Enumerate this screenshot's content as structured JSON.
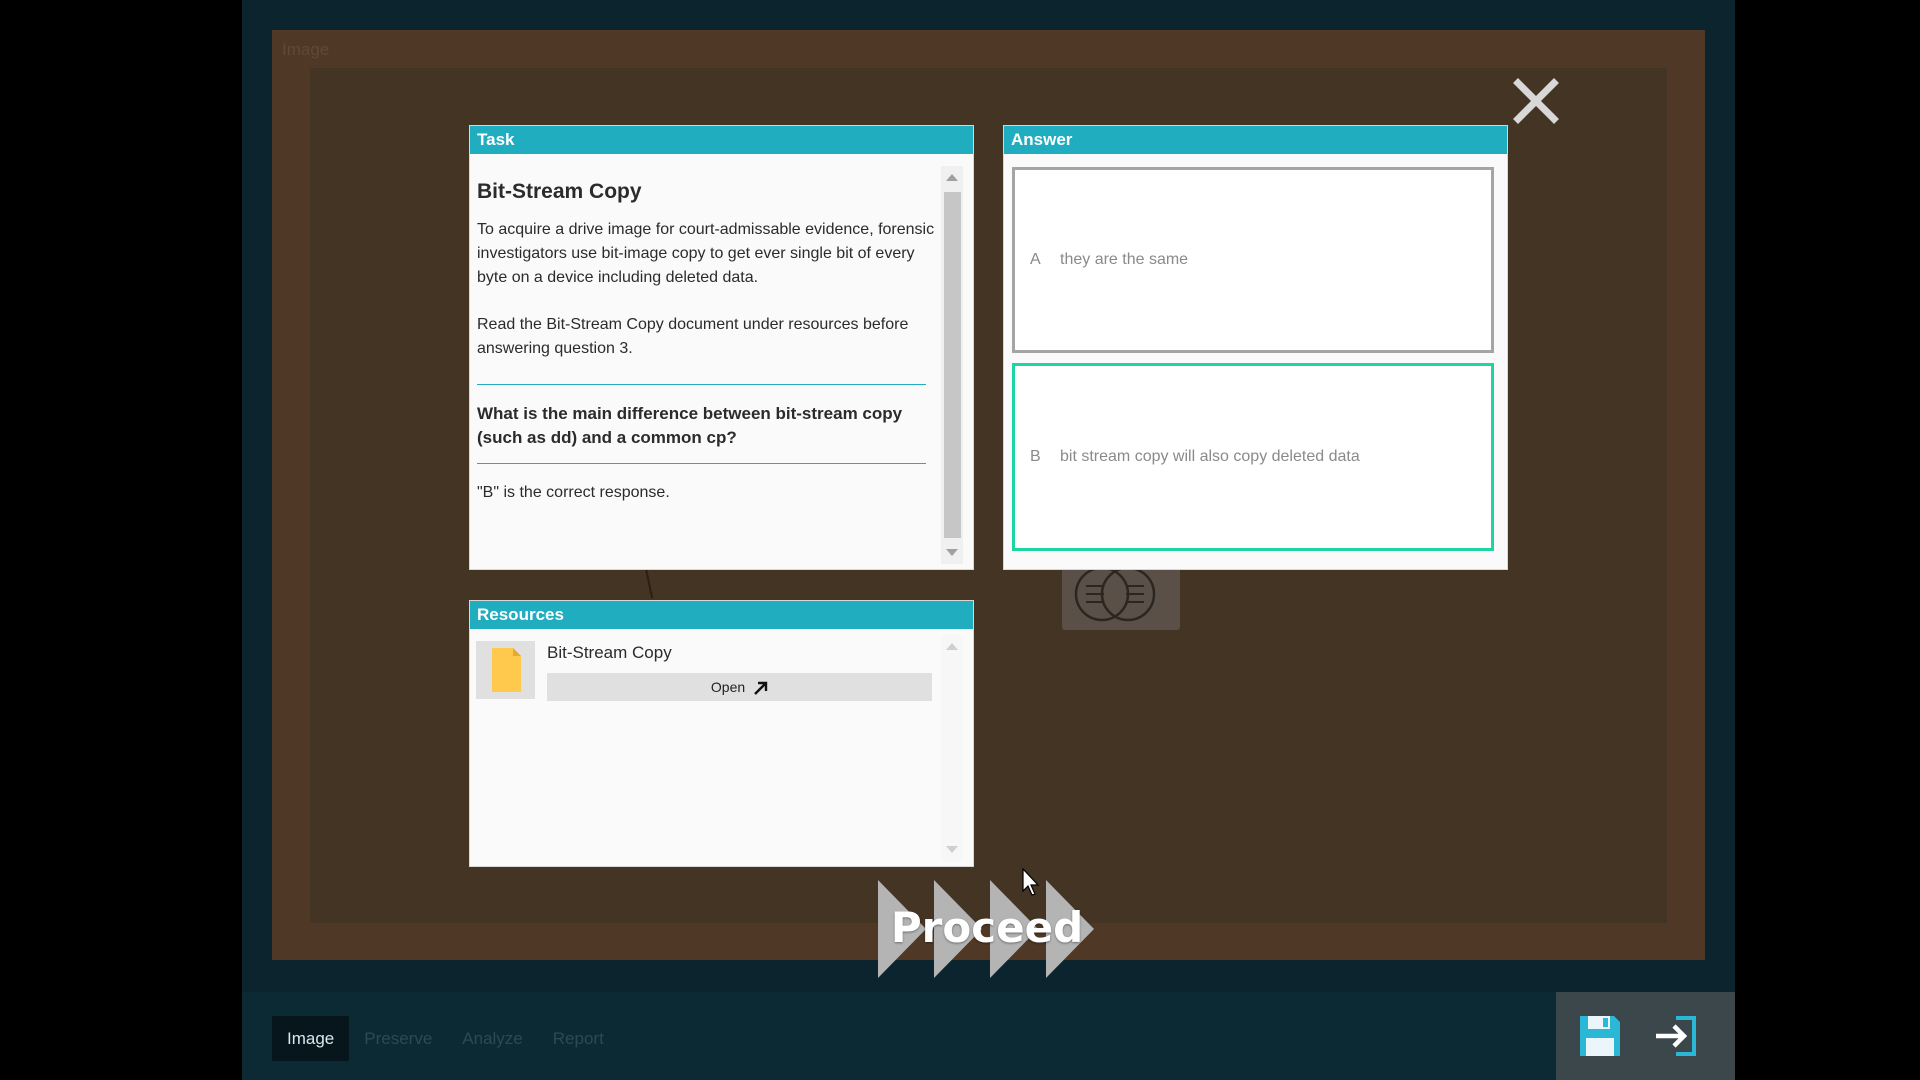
{
  "stage": {
    "label": "Image"
  },
  "task": {
    "header": "Task",
    "title": "Bit-Stream Copy",
    "paragraph1": "To acquire a drive image for court-admissable evidence, forensic investigators use bit-image copy to get ever single bit of every byte on a device including deleted data.",
    "paragraph2": "Read the Bit-Stream Copy document under resources before answering question 3.",
    "question": "What is the main difference between bit-stream copy (such as dd) and a common cp?",
    "response": "\"B\" is the correct response."
  },
  "answer": {
    "header": "Answer",
    "choices": [
      {
        "letter": "A",
        "text": "they are the same"
      },
      {
        "letter": "B",
        "text": "bit stream copy will also copy deleted data"
      }
    ]
  },
  "resources": {
    "header": "Resources",
    "items": [
      {
        "name": "Bit-Stream Copy",
        "open_label": "Open"
      }
    ]
  },
  "proceed": {
    "label": "Proceed"
  },
  "tabs": [
    {
      "label": "Image",
      "active": true
    },
    {
      "label": "Preserve",
      "active": false
    },
    {
      "label": "Analyze",
      "active": false
    },
    {
      "label": "Report",
      "active": false
    }
  ],
  "colors": {
    "accent": "#20adbf",
    "selected": "#1ed4a0",
    "stage": "#4f3926",
    "app_bg": "#0b242d"
  },
  "icons": {
    "close": "close-icon",
    "file": "file-icon",
    "open": "external-link-icon",
    "save": "save-icon",
    "exit": "exit-icon"
  }
}
